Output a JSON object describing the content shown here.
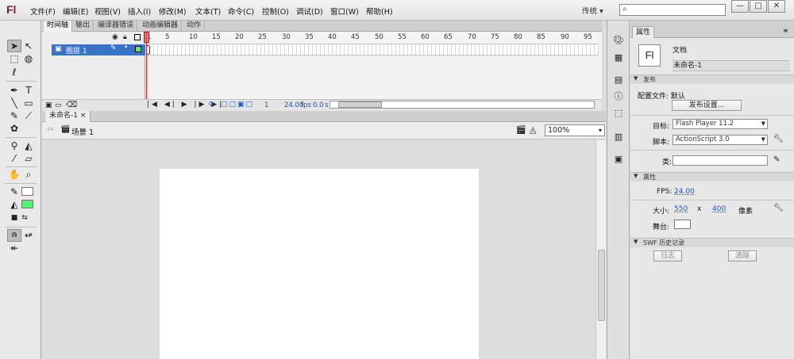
{
  "app": {
    "logo": "Fl"
  },
  "menubar": {
    "items": [
      "文件(F)",
      "编辑(E)",
      "视图(V)",
      "插入(I)",
      "修改(M)",
      "文本(T)",
      "命令(C)",
      "控制(O)",
      "调试(D)",
      "窗口(W)",
      "帮助(H)"
    ],
    "workspace": "传统 ▾",
    "search_placeholder": "",
    "window_buttons": [
      "—",
      "□",
      "✕"
    ]
  },
  "timeline": {
    "tabs": [
      "时间轴",
      "输出",
      "编译器错误",
      "动画编辑器",
      "动作"
    ],
    "layer_name": "图层 1",
    "frame_numbers": [
      "1",
      "5",
      "10",
      "15",
      "20",
      "25",
      "30",
      "35",
      "40",
      "45",
      "50",
      "55",
      "60",
      "65",
      "70",
      "75",
      "80",
      "85",
      "90",
      "95"
    ],
    "current_frame": "1",
    "fps_value": "24.00",
    "fps_unit": "fps",
    "time_value": "0.0",
    "time_unit": "s"
  },
  "document": {
    "tab_name": "未命名-1",
    "scene_name": "场景 1",
    "zoom": "100%"
  },
  "properties": {
    "tab_label": "属性",
    "doc_icon_label": "Fl",
    "doc_type": "文档",
    "doc_name": "未命名-1",
    "publish_section": "发布",
    "profile_label": "配置文件: 默认",
    "publish_settings_button": "发布设置...",
    "target_label": "目标:",
    "target_value": "Flash Player 11.2",
    "script_label": "脚本:",
    "script_value": "ActionScript 3.0",
    "class_label": "类:",
    "class_value": "",
    "attr_section": "属性",
    "fps_label": "FPS:",
    "fps_value": "24.00",
    "size_label": "大小:",
    "width_value": "550",
    "size_x": "x",
    "height_value": "400",
    "size_unit": "像素",
    "stage_label": "舞台:",
    "swf_section": "SWF 历史记录",
    "log_button": "日志",
    "clear_button": "清除"
  },
  "colors": {
    "layer_highlight": "#3a72c8",
    "playhead": "#dd2222",
    "fill_color": "#55ee77",
    "logo": "#7a1f2b"
  },
  "icons": {
    "tools": [
      "selection-arrow-icon",
      "subselection-icon",
      "free-transform-icon",
      "3d-rotation-icon",
      "lasso-icon",
      "pen-icon",
      "text-icon",
      "line-icon",
      "rectangle-icon",
      "pencil-icon",
      "brush-icon",
      "deco-icon",
      "bone-icon",
      "paint-bucket-icon",
      "eyedropper-icon",
      "eraser-icon",
      "hand-icon",
      "zoom-icon",
      "stroke-color-icon",
      "fill-color-icon"
    ],
    "dock": [
      "color-icon",
      "swatches-icon",
      "align-icon",
      "info-icon",
      "transform-icon",
      "library-icon",
      "components-icon"
    ]
  }
}
